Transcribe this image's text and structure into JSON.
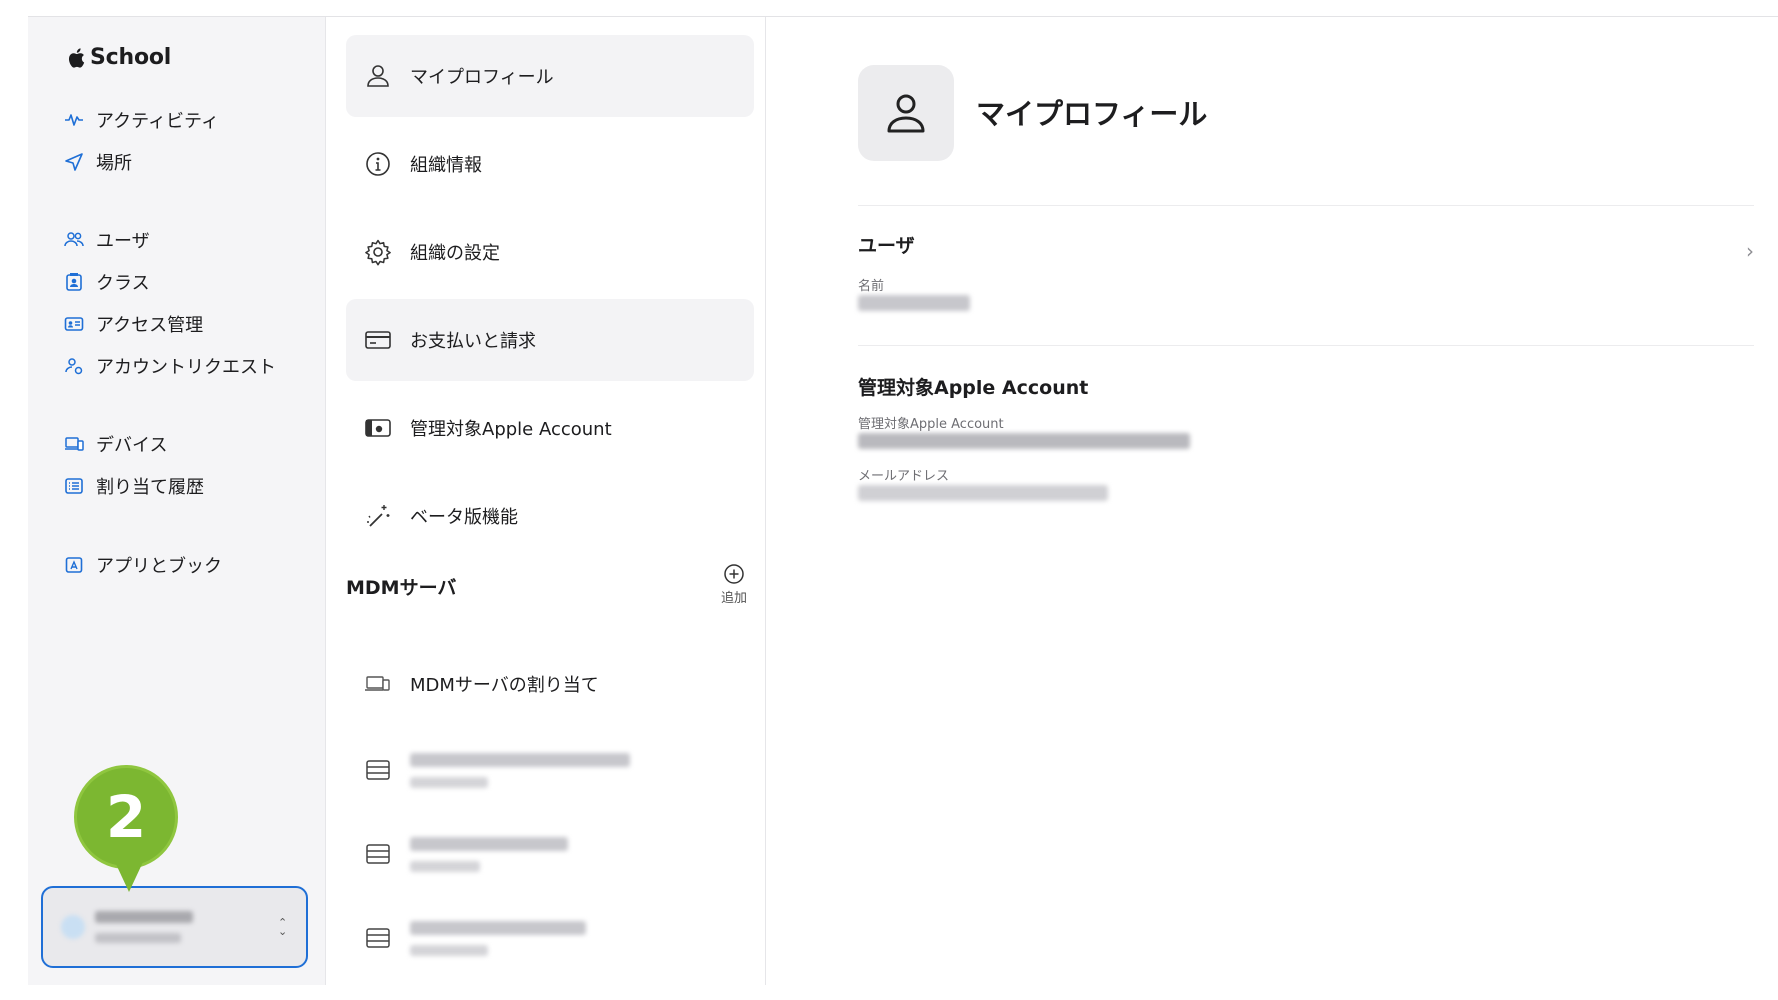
{
  "sidebar": {
    "brand": "School",
    "nav": [
      {
        "label": "アクティビティ",
        "icon": "activity-icon"
      },
      {
        "label": "場所",
        "icon": "location-icon"
      },
      {
        "label": "ユーザ",
        "icon": "users-icon"
      },
      {
        "label": "クラス",
        "icon": "class-icon"
      },
      {
        "label": "アクセス管理",
        "icon": "access-card-icon"
      },
      {
        "label": "アカウントリクエスト",
        "icon": "account-request-icon"
      },
      {
        "label": "デバイス",
        "icon": "devices-icon"
      },
      {
        "label": "割り当て履歴",
        "icon": "assignment-history-icon"
      },
      {
        "label": "アプリとブック",
        "icon": "apps-books-icon"
      }
    ],
    "account_chevron": "⌃⌄",
    "callout_number": "2"
  },
  "settings": {
    "items": [
      {
        "label": "マイプロフィール",
        "icon": "person-icon"
      },
      {
        "label": "組織情報",
        "icon": "info-icon"
      },
      {
        "label": "組織の設定",
        "icon": "gear-icon"
      },
      {
        "label": "お支払いと請求",
        "icon": "credit-card-icon"
      },
      {
        "label": "管理対象Apple Account",
        "icon": "apple-account-icon"
      },
      {
        "label": "ベータ版機能",
        "icon": "magic-wand-icon"
      }
    ],
    "mdm_header": "MDMサーバ",
    "add_label": "追加",
    "mdm_assign": "MDMサーバの割り当て"
  },
  "detail": {
    "title": "マイプロフィール",
    "user_section": "ユーザ",
    "name_label": "名前",
    "account_section": "管理対象Apple Account",
    "account_label": "管理対象Apple Account",
    "email_label": "メールアドレス",
    "chevron": "›"
  },
  "colors": {
    "accent": "#1f6fd6",
    "callout": "#7cb731",
    "selected_row": "#f3f3f5"
  }
}
